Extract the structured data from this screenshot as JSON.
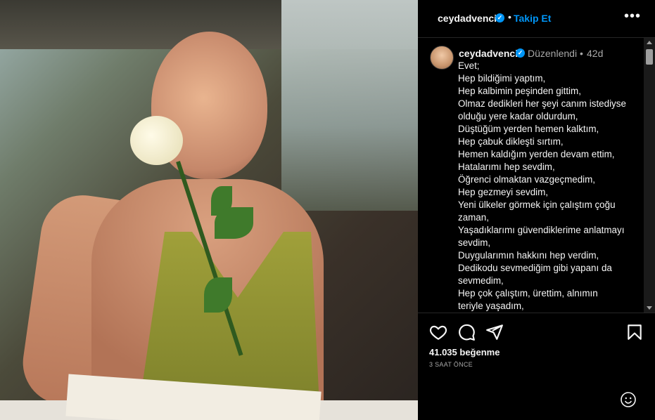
{
  "header": {
    "username": "ceydadvenci",
    "separator": "•",
    "follow_label": "Takip Et",
    "more_label": "•••"
  },
  "caption": {
    "username": "ceydadvenci",
    "edited": "Düzenlendi •",
    "time": "42d",
    "lines": [
      "Evet;",
      "Hep bildiğimi yaptım,",
      "Hep kalbimin peşinden gittim,",
      "Olmaz dedikleri her şeyi canım istediyse",
      "olduğu yere kadar oldurdum,",
      "Düştüğüm yerden hemen kalktım,",
      "Hep çabuk dikleşti sırtım,",
      "Hemen kaldığım yerden devam ettim,",
      "Hatalarımı hep sevdim,",
      "Öğrenci olmaktan vazgeçmedim,",
      "Hep gezmeyi sevdim,",
      "Yeni ülkeler görmek için çalıştım çoğu",
      "zaman,",
      "Yaşadıklarımı güvendiklerime anlatmayı",
      "sevdim,",
      "Duygularımın hakkını hep verdim,",
      "Dedikodu sevmediğim gibi yapanı da",
      "sevmedim,",
      "Hep çok çalıştım, ürettim, alnımın",
      "teriyle yaşadım,"
    ]
  },
  "footer": {
    "likes": "41.035 beğenme",
    "posted": "3 SAAT ÖNCE"
  },
  "colors": {
    "accent": "#0095f6",
    "background": "#000000",
    "text": "#f5f5f5",
    "muted": "#a8a8a8"
  },
  "icons": {
    "like": "heart-icon",
    "comment": "comment-icon",
    "share": "share-icon",
    "save": "bookmark-icon",
    "emoji": "emoji-icon",
    "verified": "verified-badge-icon",
    "more": "more-options-icon"
  }
}
